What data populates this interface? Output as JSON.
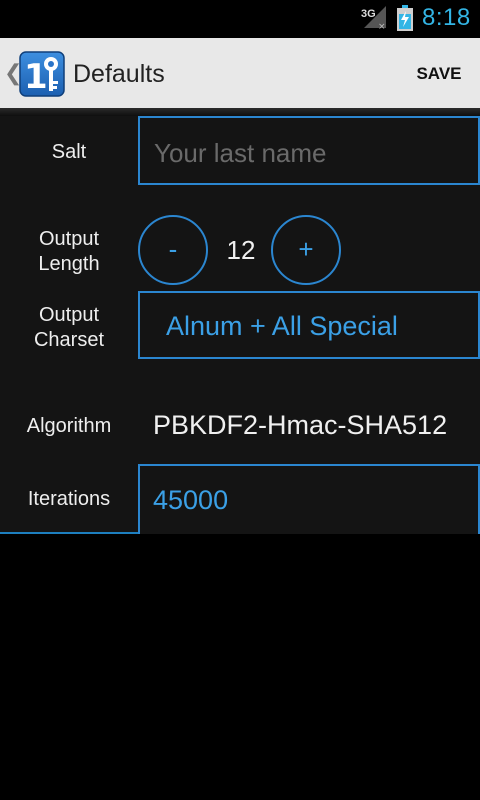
{
  "status_bar": {
    "network": "3G",
    "time": "8:18",
    "signal_icon": "signal-icon",
    "battery_icon": "battery-charging-icon",
    "accent_color": "#33b5e5"
  },
  "action_bar": {
    "title": "Defaults",
    "save_label": "SAVE",
    "up_icon": "chevron-left-icon",
    "app_icon": "app-key-icon"
  },
  "form": {
    "salt_label": "Salt",
    "salt_placeholder": "Your last name",
    "salt_value": "",
    "output_length_label_line1": "Output",
    "output_length_label_line2": "Length",
    "minus_label": "-",
    "plus_label": "+",
    "output_length_value": "12",
    "output_charset_label_line1": "Output",
    "output_charset_label_line2": "Charset",
    "output_charset_value": "Alnum + All Special",
    "algorithm_label": "Algorithm",
    "algorithm_value": "PBKDF2-Hmac-SHA512",
    "iterations_label": "Iterations",
    "iterations_value": "45000"
  },
  "colors": {
    "accent_blue": "#3ba0e6",
    "border_blue": "#2b86d0",
    "action_bar_bg": "#e8e8e8",
    "content_bg": "#141414"
  }
}
